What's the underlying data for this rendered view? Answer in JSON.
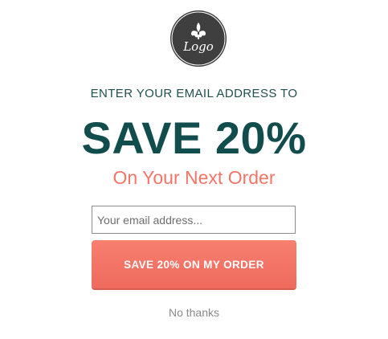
{
  "logo": {
    "text": "Logo",
    "icon": "fleur-de-lis-icon",
    "background": "#3f3f3f"
  },
  "offer": {
    "eyebrow": "ENTER YOUR EMAIL ADDRESS TO",
    "headline": "SAVE 20%",
    "subhead": "On Your Next Order"
  },
  "form": {
    "email_placeholder": "Your email address...",
    "email_value": "",
    "submit_label": "SAVE 20% ON MY ORDER"
  },
  "dismiss": {
    "label": "No thanks"
  },
  "colors": {
    "headline": "#114d4d",
    "accent": "#f47566",
    "button": "#f1705f"
  }
}
